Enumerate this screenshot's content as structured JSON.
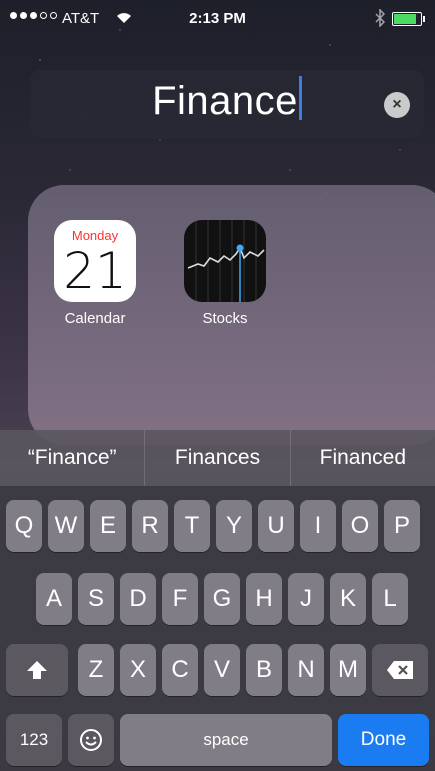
{
  "status": {
    "carrier": "AT&T",
    "time": "2:13 PM",
    "bluetooth": "bluetooth-icon",
    "battery_level": 0.85,
    "battery_color": "#4cd964"
  },
  "search": {
    "value": "Finance",
    "clear": "×"
  },
  "results": [
    {
      "name": "Calendar",
      "day": "Monday",
      "date": "21"
    },
    {
      "name": "Stocks"
    }
  ],
  "suggestions": [
    "“Finance”",
    "Finances",
    "Financed"
  ],
  "keyboard": {
    "row1": [
      "Q",
      "W",
      "E",
      "R",
      "T",
      "Y",
      "U",
      "I",
      "O",
      "P"
    ],
    "row2": [
      "A",
      "S",
      "D",
      "F",
      "G",
      "H",
      "J",
      "K",
      "L"
    ],
    "row3": [
      "Z",
      "X",
      "C",
      "V",
      "B",
      "N",
      "M"
    ],
    "numbers": "123",
    "space": "space",
    "done": "Done"
  },
  "colors": {
    "accent": "#1a7cf0",
    "calendar_red": "#ff3b30"
  }
}
